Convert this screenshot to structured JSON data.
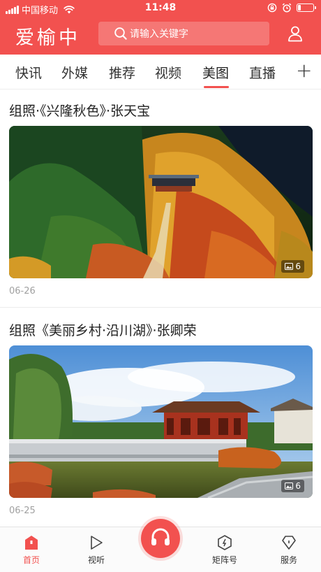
{
  "status_bar": {
    "carrier": "中国移动",
    "time": "11:48",
    "icons": [
      "signal-icon",
      "wifi-icon",
      "rotation-lock-icon",
      "alarm-icon",
      "battery-icon"
    ],
    "battery_level": 0.2
  },
  "header": {
    "logo": "爱榆中",
    "search_placeholder": "请输入关键字",
    "brand_color": "#f2514f",
    "user_icon": "user-icon"
  },
  "tabs": {
    "items": [
      "快讯",
      "外媒",
      "推荐",
      "视频",
      "美图",
      "直播"
    ],
    "active": "美图",
    "add_label": "+"
  },
  "feed": [
    {
      "title": "组照·《兴隆秋色》·张天宝",
      "photo_count": "6",
      "date": "06-26"
    },
    {
      "title": "组照《美丽乡村·沿川湖》·张卿荣",
      "photo_count": "6",
      "date": "06-25"
    }
  ],
  "bottom_nav": {
    "items": [
      {
        "label": "首页",
        "icon": "home-icon",
        "active": true
      },
      {
        "label": "视听",
        "icon": "play-icon",
        "active": false
      },
      {
        "label": "",
        "icon": "headset-icon",
        "active": false
      },
      {
        "label": "矩阵号",
        "icon": "hexagon-icon",
        "active": false
      },
      {
        "label": "服务",
        "icon": "diamond-icon",
        "active": false
      }
    ]
  }
}
